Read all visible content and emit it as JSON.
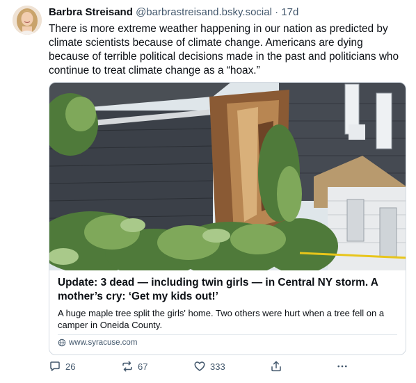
{
  "post": {
    "author_name": "Barbra Streisand",
    "handle": "@barbrastreisand.bsky.social",
    "separator": "·",
    "time": "17d",
    "text": "There is more extreme weather happening in our nation as predicted by climate scientists because of climate change. Americans are dying because of terrible political decisions made in the past and politicians who continue to treat climate change as a “hoax.”"
  },
  "embed": {
    "title": "Update: 3 dead — including twin girls — in Central NY storm. A mother’s cry: ‘Get my kids out!’",
    "description": "A huge maple tree split the girls' home. Two others were hurt when a tree fell on a camper in Oneida County.",
    "domain": "www.syracuse.com"
  },
  "actions": {
    "replies": "26",
    "reposts": "67",
    "likes": "333"
  },
  "colors": {
    "text": "#0b0f14",
    "muted": "#42576c",
    "border": "#d4dbe2"
  },
  "icons": [
    "reply-icon",
    "repost-icon",
    "like-icon",
    "share-icon",
    "more-icon",
    "globe-icon"
  ]
}
